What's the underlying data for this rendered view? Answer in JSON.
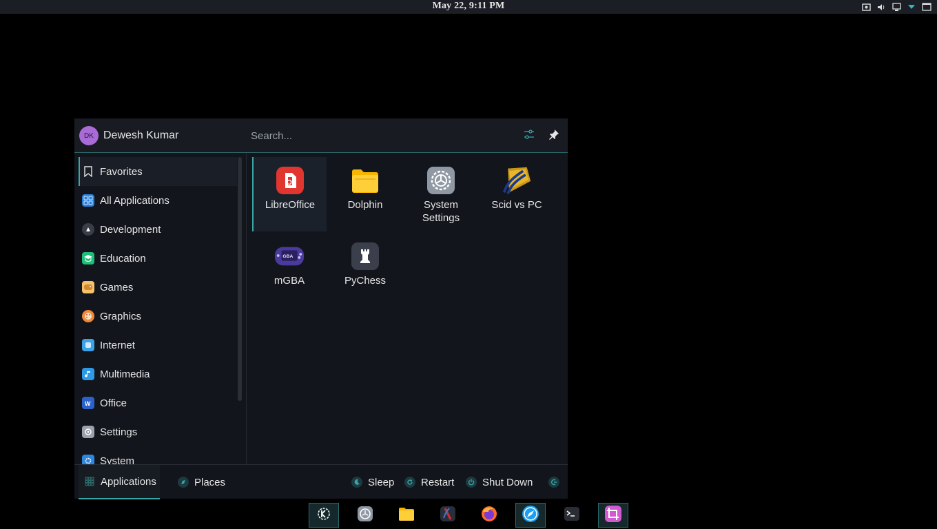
{
  "topbar": {
    "clock": "May 22, 9:11 PM",
    "tray_icons": [
      "screenshot-icon",
      "volume-icon",
      "display-icon",
      "chevron-down-icon",
      "window-icon"
    ]
  },
  "launcher": {
    "user": {
      "initials": "DK",
      "name": "Dewesh Kumar"
    },
    "search": {
      "placeholder": "Search..."
    },
    "categories": [
      {
        "label": "Favorites",
        "icon": "bookmark-icon"
      },
      {
        "label": "All Applications",
        "icon": "grid-icon"
      },
      {
        "label": "Development",
        "icon": "development-icon"
      },
      {
        "label": "Education",
        "icon": "education-icon"
      },
      {
        "label": "Games",
        "icon": "games-icon"
      },
      {
        "label": "Graphics",
        "icon": "graphics-icon"
      },
      {
        "label": "Internet",
        "icon": "internet-icon"
      },
      {
        "label": "Multimedia",
        "icon": "multimedia-icon"
      },
      {
        "label": "Office",
        "icon": "office-icon"
      },
      {
        "label": "Settings",
        "icon": "settings-icon"
      },
      {
        "label": "System",
        "icon": "system-icon"
      }
    ],
    "apps": [
      {
        "label": "LibreOffice",
        "icon": "libreoffice-icon"
      },
      {
        "label": "Dolphin",
        "icon": "folder-icon"
      },
      {
        "label": "System Settings",
        "icon": "system-settings-icon"
      },
      {
        "label": "Scid vs PC",
        "icon": "scid-icon"
      },
      {
        "label": "mGBA",
        "icon": "gameboy-icon"
      },
      {
        "label": "PyChess",
        "icon": "chess-rook-icon"
      }
    ],
    "footer": {
      "tabs": [
        {
          "label": "Applications",
          "icon": "applications-icon"
        },
        {
          "label": "Places",
          "icon": "places-icon"
        }
      ],
      "power": [
        {
          "label": "Sleep",
          "icon": "sleep-icon"
        },
        {
          "label": "Restart",
          "icon": "restart-icon"
        },
        {
          "label": "Shut Down",
          "icon": "power-icon"
        }
      ]
    }
  },
  "dock": [
    "kde-icon",
    "system-settings-icon",
    "files-icon",
    "chess-app-icon",
    "firefox-icon",
    "browser-icon",
    "terminal-icon",
    "screenshot-tool-icon"
  ],
  "colors": {
    "accent": "#3aa6a6",
    "panel": "#1b1e25",
    "launcher_bg": "#13151c"
  }
}
